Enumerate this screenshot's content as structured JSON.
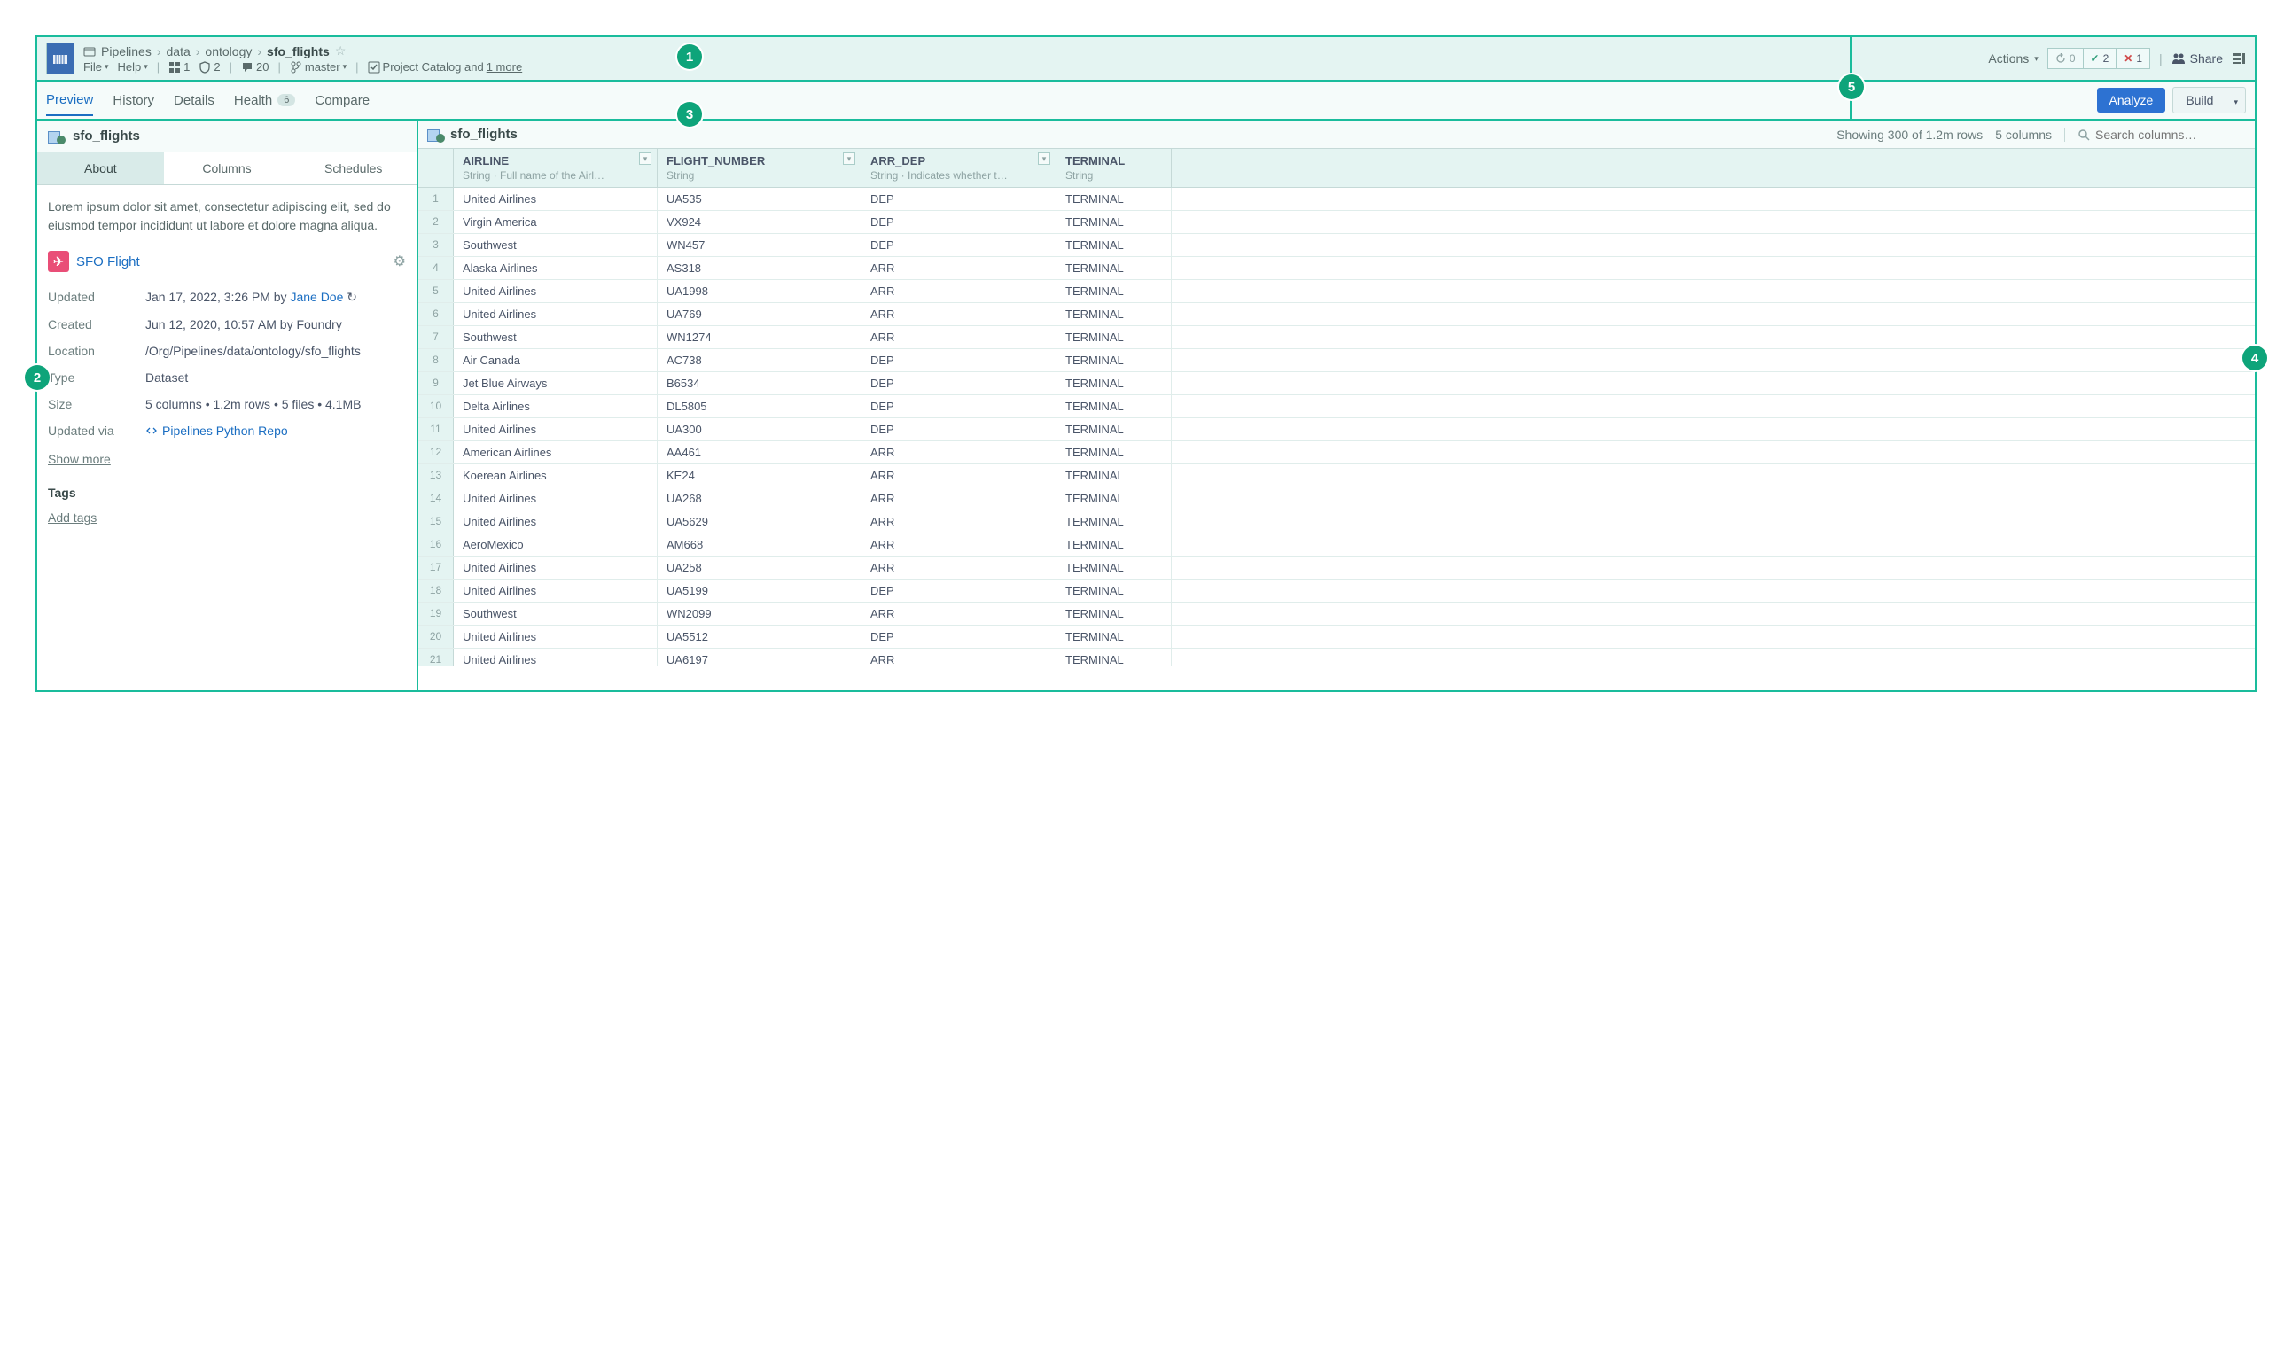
{
  "breadcrumb": {
    "items": [
      "Pipelines",
      "data",
      "ontology"
    ],
    "current": "sfo_flights"
  },
  "menu": {
    "file": "File",
    "help": "Help",
    "stat1": "1",
    "stat2": "2",
    "comments": "20",
    "branch": "master",
    "catalog_prefix": "Project Catalog and ",
    "catalog_link": "1 more"
  },
  "actions": {
    "label": "Actions",
    "refresh": "0",
    "checks": "2",
    "errors": "1",
    "share": "Share"
  },
  "tabs": {
    "preview": "Preview",
    "history": "History",
    "details": "Details",
    "health": "Health",
    "health_count": "6",
    "compare": "Compare",
    "analyze": "Analyze",
    "build": "Build"
  },
  "sidebar": {
    "title": "sfo_flights",
    "tab_about": "About",
    "tab_columns": "Columns",
    "tab_schedules": "Schedules",
    "description": "Lorem ipsum dolor sit amet, consectetur adipiscing elit, sed do eiusmod tempor incididunt ut labore et dolore magna aliqua.",
    "entity_name": "SFO Flight",
    "meta": {
      "updated_label": "Updated",
      "updated_value": "Jan 17, 2022, 3:26 PM by ",
      "updated_user": "Jane Doe",
      "created_label": "Created",
      "created_value": "Jun 12, 2020, 10:57 AM by Foundry",
      "location_label": "Location",
      "location_value": "/Org/Pipelines/data/ontology/sfo_flights",
      "type_label": "Type",
      "type_value": "Dataset",
      "size_label": "Size",
      "size_value": "5 columns • 1.2m rows • 5 files • 4.1MB",
      "updated_via_label": "Updated via",
      "updated_via_value": "Pipelines Python Repo"
    },
    "show_more": "Show more",
    "tags_title": "Tags",
    "add_tags": "Add tags"
  },
  "data_header": {
    "name": "sfo_flights",
    "showing": "Showing 300 of 1.2m rows",
    "columns": "5 columns",
    "search_placeholder": "Search columns…"
  },
  "columns": [
    {
      "name": "AIRLINE",
      "type": "String · Full name of the Airl…"
    },
    {
      "name": "FLIGHT_NUMBER",
      "type": "String"
    },
    {
      "name": "ARR_DEP",
      "type": "String · Indicates whether t…"
    },
    {
      "name": "TERMINAL",
      "type": "String"
    }
  ],
  "rows": [
    {
      "airline": "United Airlines",
      "flight": "UA535",
      "ad": "DEP",
      "term": "TERMINAL"
    },
    {
      "airline": "Virgin America",
      "flight": "VX924",
      "ad": "DEP",
      "term": "TERMINAL"
    },
    {
      "airline": "Southwest",
      "flight": "WN457",
      "ad": "DEP",
      "term": "TERMINAL"
    },
    {
      "airline": "Alaska Airlines",
      "flight": "AS318",
      "ad": "ARR",
      "term": "TERMINAL"
    },
    {
      "airline": "United Airlines",
      "flight": "UA1998",
      "ad": "ARR",
      "term": "TERMINAL"
    },
    {
      "airline": "United Airlines",
      "flight": "UA769",
      "ad": "ARR",
      "term": "TERMINAL"
    },
    {
      "airline": "Southwest",
      "flight": "WN1274",
      "ad": "ARR",
      "term": "TERMINAL"
    },
    {
      "airline": "Air Canada",
      "flight": "AC738",
      "ad": "DEP",
      "term": "TERMINAL"
    },
    {
      "airline": "Jet Blue Airways",
      "flight": "B6534",
      "ad": "DEP",
      "term": "TERMINAL"
    },
    {
      "airline": "Delta Airlines",
      "flight": "DL5805",
      "ad": "DEP",
      "term": "TERMINAL"
    },
    {
      "airline": "United Airlines",
      "flight": "UA300",
      "ad": "DEP",
      "term": "TERMINAL"
    },
    {
      "airline": "American Airlines",
      "flight": "AA461",
      "ad": "ARR",
      "term": "TERMINAL"
    },
    {
      "airline": "Koerean Airlines",
      "flight": "KE24",
      "ad": "ARR",
      "term": "TERMINAL"
    },
    {
      "airline": "United Airlines",
      "flight": "UA268",
      "ad": "ARR",
      "term": "TERMINAL"
    },
    {
      "airline": "United Airlines",
      "flight": "UA5629",
      "ad": "ARR",
      "term": "TERMINAL"
    },
    {
      "airline": "AeroMexico",
      "flight": "AM668",
      "ad": "ARR",
      "term": "TERMINAL"
    },
    {
      "airline": "United Airlines",
      "flight": "UA258",
      "ad": "ARR",
      "term": "TERMINAL"
    },
    {
      "airline": "United Airlines",
      "flight": "UA5199",
      "ad": "DEP",
      "term": "TERMINAL"
    },
    {
      "airline": "Southwest",
      "flight": "WN2099",
      "ad": "ARR",
      "term": "TERMINAL"
    },
    {
      "airline": "United Airlines",
      "flight": "UA5512",
      "ad": "DEP",
      "term": "TERMINAL"
    },
    {
      "airline": "United Airlines",
      "flight": "UA6197",
      "ad": "ARR",
      "term": "TERMINAL"
    }
  ],
  "callouts": {
    "c1": "1",
    "c2": "2",
    "c3": "3",
    "c4": "4",
    "c5": "5"
  }
}
